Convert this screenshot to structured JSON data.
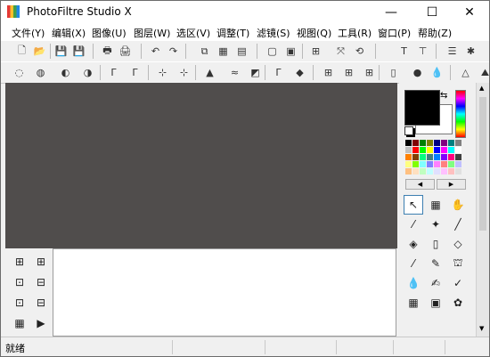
{
  "window": {
    "title": "PhotoFiltre Studio X",
    "minimize": "—",
    "maximize": "☐",
    "close": "✕"
  },
  "menu": [
    {
      "label": "文件(Y)"
    },
    {
      "label": "编辑(X)"
    },
    {
      "label": "图像(U)"
    },
    {
      "label": "图层(W)"
    },
    {
      "label": "选区(V)"
    },
    {
      "label": "调整(T)"
    },
    {
      "label": "滤镜(S)"
    },
    {
      "label": "视图(Q)"
    },
    {
      "label": "工具(R)"
    },
    {
      "label": "窗口(P)"
    },
    {
      "label": "帮助(Z)"
    }
  ],
  "toolbar1": [
    {
      "name": "new-icon",
      "glyph": "🗋"
    },
    {
      "name": "open-icon",
      "glyph": "📂"
    },
    {
      "name": "save-icon",
      "glyph": "💾"
    },
    {
      "name": "save-as-icon",
      "glyph": "💾"
    },
    {
      "name": "print-icon",
      "glyph": "🖶"
    },
    {
      "name": "scan-icon",
      "glyph": "🖨"
    },
    {
      "name": "undo-icon",
      "glyph": "↶"
    },
    {
      "name": "redo-icon",
      "glyph": "↷"
    },
    {
      "name": "copy-icon",
      "glyph": "⧉"
    },
    {
      "name": "paste-icon",
      "glyph": "▦"
    },
    {
      "name": "paste-new-icon",
      "glyph": "▤"
    },
    {
      "name": "image-size-icon",
      "glyph": "▢"
    },
    {
      "name": "canvas-size-icon",
      "glyph": "▣"
    },
    {
      "name": "crop-icon",
      "glyph": "⊞"
    },
    {
      "name": "transform-icon",
      "glyph": "⤧"
    },
    {
      "name": "rotate-icon",
      "glyph": "⟲"
    },
    {
      "name": "text-icon",
      "glyph": "T"
    },
    {
      "name": "text-layer-icon",
      "glyph": "⊤"
    },
    {
      "name": "layer-manager-icon",
      "glyph": "☰"
    },
    {
      "name": "settings-icon",
      "glyph": "✱"
    }
  ],
  "toolbar2": [
    {
      "name": "dodge-icon",
      "glyph": "◌"
    },
    {
      "name": "burn-icon",
      "glyph": "◍"
    },
    {
      "name": "brightness-down-icon",
      "glyph": "◐"
    },
    {
      "name": "brightness-up-icon",
      "glyph": "◑"
    },
    {
      "name": "gamma-down-icon",
      "glyph": "Γ"
    },
    {
      "name": "gamma-up-icon",
      "glyph": "Γ"
    },
    {
      "name": "saturation-down-icon",
      "glyph": "⊹"
    },
    {
      "name": "saturation-up-icon",
      "glyph": "⊹"
    },
    {
      "name": "levels-icon",
      "glyph": "▲"
    },
    {
      "name": "curves-icon",
      "glyph": "≈"
    },
    {
      "name": "invert-icon",
      "glyph": "◩"
    },
    {
      "name": "auto-levels-icon",
      "glyph": "Γ"
    },
    {
      "name": "auto-contrast-icon",
      "glyph": "◆"
    },
    {
      "name": "grid-1-icon",
      "glyph": "⊞"
    },
    {
      "name": "grid-2-icon",
      "glyph": "⊞"
    },
    {
      "name": "grid-3-icon",
      "glyph": "⊞"
    },
    {
      "name": "frame-icon",
      "glyph": "▯"
    },
    {
      "name": "blur-icon",
      "glyph": "●"
    },
    {
      "name": "drop-icon",
      "glyph": "💧"
    },
    {
      "name": "sharpen-icon",
      "glyph": "△"
    },
    {
      "name": "mountain-icon",
      "glyph": "⛰"
    },
    {
      "name": "mountain-2-icon",
      "glyph": "⛰"
    }
  ],
  "tools": [
    {
      "name": "selection-tool-icon",
      "glyph": "↖"
    },
    {
      "name": "magic-select-icon",
      "glyph": "▦"
    },
    {
      "name": "hand-tool-icon",
      "glyph": "✋"
    },
    {
      "name": "color-picker-icon",
      "glyph": "⁄"
    },
    {
      "name": "magic-wand-icon",
      "glyph": "✦"
    },
    {
      "name": "line-tool-icon",
      "glyph": "╱"
    },
    {
      "name": "fill-tool-icon",
      "glyph": "◈"
    },
    {
      "name": "spray-tool-icon",
      "glyph": "▯"
    },
    {
      "name": "eraser-tool-icon",
      "glyph": "◇"
    },
    {
      "name": "brush-tool-icon",
      "glyph": "⁄"
    },
    {
      "name": "advanced-brush-icon",
      "glyph": "✎"
    },
    {
      "name": "stamp-tool-icon",
      "glyph": "⛫"
    },
    {
      "name": "blur-tool-icon",
      "glyph": "💧"
    },
    {
      "name": "smudge-tool-icon",
      "glyph": "✍"
    },
    {
      "name": "sharpen-tool-icon",
      "glyph": "✓"
    },
    {
      "name": "pattern-tool-icon",
      "glyph": "▦"
    },
    {
      "name": "clone-tool-icon",
      "glyph": "▣"
    },
    {
      "name": "warp-tool-icon",
      "glyph": "✿"
    }
  ],
  "left_tools": [
    {
      "name": "layer-tree-icon",
      "glyph": "⊞"
    },
    {
      "name": "layer-add-icon",
      "glyph": "⊞"
    },
    {
      "name": "layer-yellow-icon",
      "glyph": "⊡"
    },
    {
      "name": "layer-save-icon",
      "glyph": "⊟"
    },
    {
      "name": "layer-select-icon",
      "glyph": "⊡"
    },
    {
      "name": "layer-copy-icon",
      "glyph": "⊟"
    },
    {
      "name": "layer-pattern-icon",
      "glyph": "▦"
    },
    {
      "name": "play-icon",
      "glyph": "▶"
    }
  ],
  "colors": {
    "foreground": "#000000",
    "background": "#ffffff",
    "workspace": "#504d4c"
  },
  "palette": [
    "#000000",
    "#800000",
    "#008000",
    "#808000",
    "#000080",
    "#800080",
    "#008080",
    "#808080",
    "#c0c0c0",
    "#ff0000",
    "#00ff00",
    "#ffff00",
    "#0000ff",
    "#ff00ff",
    "#00ffff",
    "#ffffff",
    "#ff8000",
    "#804000",
    "#00ff80",
    "#408080",
    "#0080ff",
    "#8000ff",
    "#ff0080",
    "#404040",
    "#ffff80",
    "#80ff00",
    "#80ffff",
    "#8080ff",
    "#ff80ff",
    "#ff8080",
    "#80ff80",
    "#c0c0ff",
    "#ffc080",
    "#ffe0c0",
    "#c0ffc0",
    "#c0ffff",
    "#e0e0ff",
    "#ffc0ff",
    "#ffc0c0",
    "#e0e0e0"
  ],
  "palette_nav": {
    "prev": "◀",
    "next": "▶"
  },
  "status": {
    "text": "就绪"
  }
}
